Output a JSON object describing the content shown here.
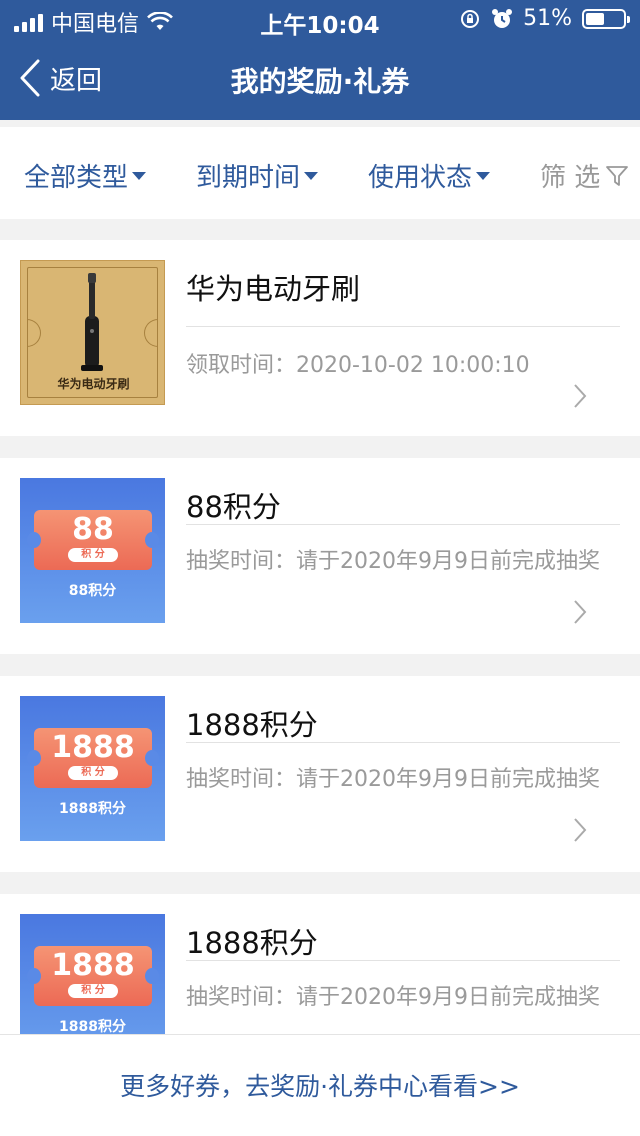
{
  "status_bar": {
    "carrier": "中国电信",
    "time": "上午10:04",
    "battery": "51%"
  },
  "nav": {
    "back_label": "返回",
    "title": "我的奖励·礼券"
  },
  "filters": [
    {
      "label": "全部类型",
      "has_dropdown": true
    },
    {
      "label": "到期时间",
      "has_dropdown": true
    },
    {
      "label": "使用状态",
      "has_dropdown": true
    },
    {
      "label": "筛 选",
      "has_dropdown": false
    }
  ],
  "rewards": [
    {
      "title": "华为电动牙刷",
      "meta": "领取时间：2020-10-02 10:00:10",
      "thumb_type": "gold",
      "thumb_caption": "华为电动牙刷"
    },
    {
      "title": "88积分",
      "meta": "抽奖时间：请于2020年9月9日前完成抽奖",
      "thumb_type": "blue",
      "ticket_value": "88",
      "ticket_unit": "积 分",
      "thumb_caption": "88积分"
    },
    {
      "title": "1888积分",
      "meta": "抽奖时间：请于2020年9月9日前完成抽奖",
      "thumb_type": "blue",
      "ticket_value": "1888",
      "ticket_unit": "积 分",
      "thumb_caption": "1888积分"
    },
    {
      "title": "1888积分",
      "meta": "抽奖时间：请于2020年9月9日前完成抽奖",
      "thumb_type": "blue",
      "ticket_value": "1888",
      "ticket_unit": "积 分",
      "thumb_caption": "1888积分"
    }
  ],
  "footer": {
    "link_text": "更多好券，去奖励·礼券中心看看>>"
  },
  "colors": {
    "brand_blue": "#2f5a9c",
    "meta_gray": "#9a9a9a"
  }
}
